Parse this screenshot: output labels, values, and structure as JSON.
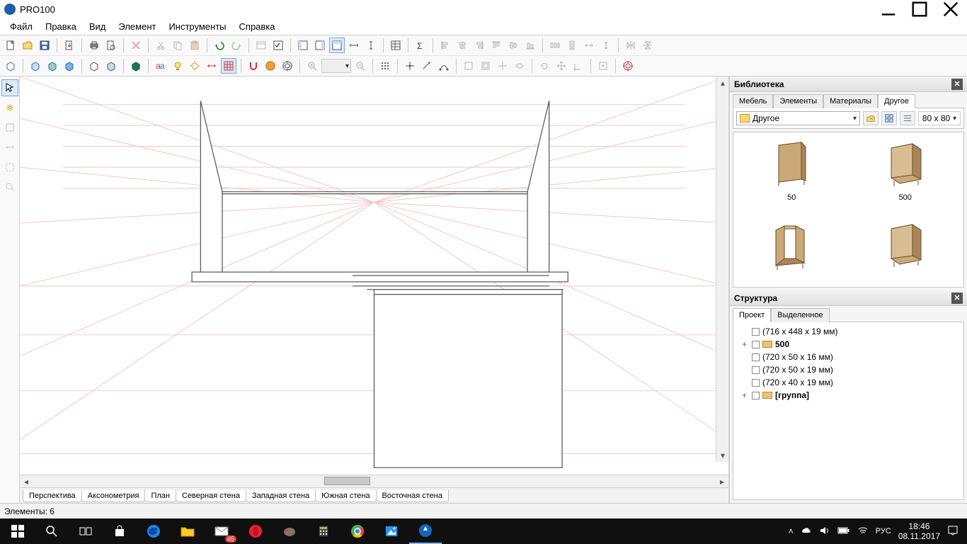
{
  "titlebar": {
    "title": "PRO100"
  },
  "menu": [
    "Файл",
    "Правка",
    "Вид",
    "Элемент",
    "Инструменты",
    "Справка"
  ],
  "viewtabs": [
    "Перспектива",
    "Аксонометрия",
    "План",
    "Северная стена",
    "Западная стена",
    "Южная стена",
    "Восточная стена"
  ],
  "statusbar": {
    "elements_label": "Элементы: 6"
  },
  "library": {
    "panel_title": "Библиотека",
    "tabs": [
      "Мебель",
      "Элементы",
      "Материалы",
      "Другое"
    ],
    "active_tab": 3,
    "folder_selected": "Другое",
    "thumb_size": "80 x  80",
    "items": [
      {
        "label": "50"
      },
      {
        "label": "500"
      },
      {
        "label": ""
      },
      {
        "label": ""
      }
    ]
  },
  "structure": {
    "panel_title": "Структура",
    "tabs": [
      "Проект",
      "Выделенное"
    ],
    "active_tab": 0,
    "rows": [
      {
        "expander": "",
        "bold": false,
        "icon": false,
        "text": "(716 x 448 x 19 мм)"
      },
      {
        "expander": "+",
        "bold": true,
        "icon": true,
        "text": "500"
      },
      {
        "expander": "",
        "bold": false,
        "icon": false,
        "text": "(720 x 50 x 16 мм)"
      },
      {
        "expander": "",
        "bold": false,
        "icon": false,
        "text": "(720 x 50 x 19 мм)"
      },
      {
        "expander": "",
        "bold": false,
        "icon": false,
        "text": "(720 x 40 x 19 мм)"
      },
      {
        "expander": "+",
        "bold": true,
        "icon": true,
        "text": "[группа]"
      }
    ]
  },
  "taskbar": {
    "time": "18:46",
    "date": "08.11.2017",
    "lang": "РУС",
    "mail_badge": "45"
  }
}
